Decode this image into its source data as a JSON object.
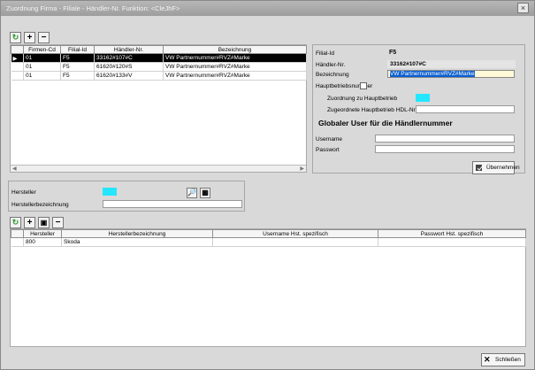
{
  "window": {
    "title": "Zuordnung Firma - Filiale - Händler-Nr. Funktion: <CleJhF>"
  },
  "top_table": {
    "columns": [
      "Firmen-Cd",
      "Filial-Id",
      "Händler-Nr.",
      "Bezeichnung"
    ],
    "rows": [
      [
        "01",
        "F5",
        "33162#107#C",
        "VW Partnernummer#RVZ#Marke"
      ],
      [
        "01",
        "F5",
        "61620#120#S",
        "VW Partnernummer#RVZ#Marke"
      ],
      [
        "01",
        "F5",
        "61620#133#V",
        "VW Partnernummer#RVZ#Marke"
      ]
    ]
  },
  "detail": {
    "filial_label": "Filial-Id",
    "filial_value": "F5",
    "haendler_label": "Händler-Nr.",
    "haendler_value": "33162#107#C",
    "bezeichnung_label": "Bezeichnung",
    "bezeichnung_value": "VW Partnernummer#RVZ#Marke",
    "hauptbetrieb_label": "Hauptbetriebsnummer",
    "zuordnung_label": "Zuordnung zu Hauptbetrieb",
    "zugeordnete_label": "Zugeordnete Hauptbetrieb HDL-Nr.",
    "global_heading": "Globaler User für die Händlernummer",
    "username_label": "Username",
    "passwort_label": "Passwort",
    "uebernehmen_label": "Übernehmen"
  },
  "manufacturer_form": {
    "hersteller_label": "Hersteller",
    "herstellerbezeichnung_label": "Herstellerbezeichnung"
  },
  "bottom_table": {
    "columns": [
      "Hersteller",
      "Herstellerbezeichnung",
      "Username Hst. spezifisch",
      "Passwort Hst. spezifisch"
    ],
    "rows": [
      [
        "800",
        "Skoda",
        "",
        ""
      ]
    ]
  },
  "footer": {
    "close_label": "Schließen"
  },
  "icons": {
    "refresh": "refresh-icon",
    "add": "plus-icon",
    "remove": "minus-icon",
    "search": "search-icon",
    "calendar": "calendar-icon",
    "save": "save-icon",
    "apply": "user-check-icon",
    "close": "x-close-icon"
  },
  "colors": {
    "accent": "#25e6ff",
    "selection": "#000000",
    "yellow_field": "#fff9d8"
  }
}
